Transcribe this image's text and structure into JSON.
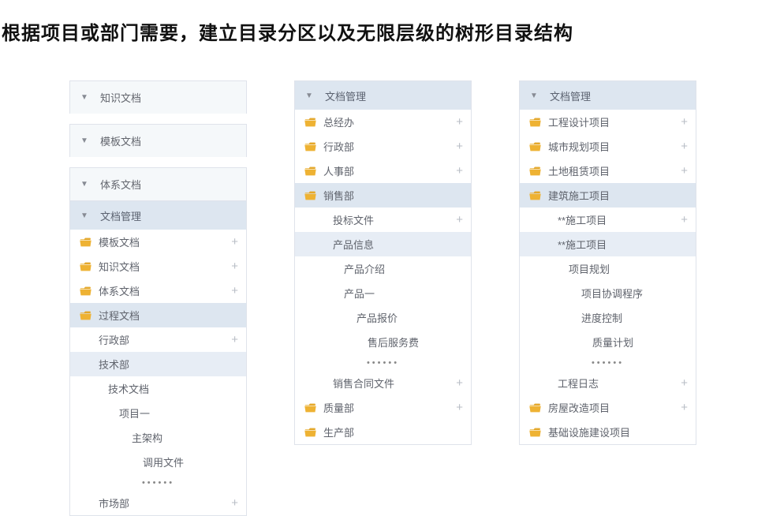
{
  "title": "根据项目或部门需要，建立目录分区以及无限层级的树形目录结构",
  "dots": "••••••",
  "left": {
    "caps": [
      "知识文档",
      "模板文档",
      "体系文档"
    ],
    "header": "文档管理",
    "items": [
      {
        "folder": true,
        "label": "模板文档",
        "plus": true
      },
      {
        "folder": true,
        "label": "知识文档",
        "plus": true
      },
      {
        "folder": true,
        "label": "体系文档",
        "plus": true
      },
      {
        "folder": true,
        "label": "过程文档",
        "sel": true
      },
      {
        "indent": 1,
        "label": "行政部",
        "plus": true
      },
      {
        "indent": 1,
        "label": "技术部",
        "sel": "light"
      },
      {
        "indent": 2,
        "label": "技术文档"
      },
      {
        "indent": 3,
        "label": "项目一"
      },
      {
        "indent": 4,
        "label": "主架构"
      },
      {
        "indent": 5,
        "label": "调用文件"
      },
      {
        "dots": true
      },
      {
        "indent": 1,
        "label": "市场部",
        "plus": true
      }
    ]
  },
  "mid": {
    "header": "文档管理",
    "items": [
      {
        "folder": true,
        "label": "总经办",
        "plus": true
      },
      {
        "folder": true,
        "label": "行政部",
        "plus": true
      },
      {
        "folder": true,
        "label": "人事部",
        "plus": true
      },
      {
        "folder": true,
        "label": "销售部",
        "sel": true
      },
      {
        "indent": 2,
        "label": "投标文件",
        "plus": true
      },
      {
        "indent": 2,
        "label": "产品信息",
        "sel": "light"
      },
      {
        "indent": 3,
        "label": "产品介绍"
      },
      {
        "indent": 3,
        "label": "产品一"
      },
      {
        "indent": 4,
        "label": "产品报价"
      },
      {
        "indent": 5,
        "label": "售后服务费"
      },
      {
        "dots": true
      },
      {
        "indent": 2,
        "label": "销售合同文件",
        "plus": true
      },
      {
        "folder": true,
        "label": "质量部",
        "plus": true
      },
      {
        "folder": true,
        "label": "生产部"
      }
    ]
  },
  "right": {
    "header": "文档管理",
    "items": [
      {
        "folder": true,
        "label": "工程设计项目",
        "plus": true
      },
      {
        "folder": true,
        "label": "城市规划项目",
        "plus": true
      },
      {
        "folder": true,
        "label": "土地租赁项目",
        "plus": true
      },
      {
        "folder": true,
        "label": "建筑施工项目",
        "sel": true
      },
      {
        "indent": 2,
        "label": "**施工项目",
        "plus": true
      },
      {
        "indent": 2,
        "label": "**施工项目",
        "sel": "light"
      },
      {
        "indent": 3,
        "label": "项目规划"
      },
      {
        "indent": 4,
        "label": "项目协调程序"
      },
      {
        "indent": 4,
        "label": "进度控制"
      },
      {
        "indent": 5,
        "label": "质量计划"
      },
      {
        "dots": true
      },
      {
        "indent": 2,
        "label": "工程日志",
        "plus": true
      },
      {
        "folder": true,
        "label": "房屋改造项目",
        "plus": true
      },
      {
        "folder": true,
        "label": "基础设施建设项目"
      }
    ]
  }
}
